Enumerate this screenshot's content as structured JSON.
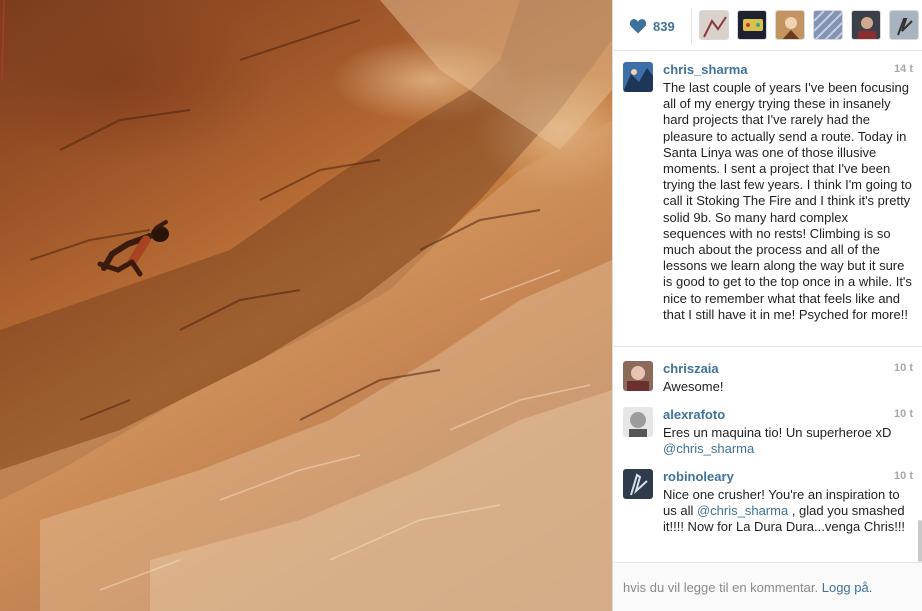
{
  "likes": {
    "count": "839",
    "icon": "heart-icon",
    "likers": [
      {
        "avatar": "liker-avatar-1",
        "color": "#c9c3bd"
      },
      {
        "avatar": "liker-avatar-2",
        "color": "#2b2b3a"
      },
      {
        "avatar": "liker-avatar-3",
        "color": "#b88a5a"
      },
      {
        "avatar": "liker-avatar-4",
        "color": "#7d8aa8"
      },
      {
        "avatar": "liker-avatar-5",
        "color": "#3a3f4a"
      },
      {
        "avatar": "liker-avatar-6",
        "color": "#9aa7b8"
      }
    ]
  },
  "caption": {
    "username": "chris_sharma",
    "time": "14 t",
    "text": "The last couple of years I've been focusing all of my energy trying these in insanely hard projects that I've rarely had the pleasure to actually send a route. Today in Santa Linya was one of those illusive moments. I sent a project that I've been trying the last few years. I think I'm going to call it Stoking The Fire and I think it's pretty solid 9b. So many hard complex sequences with no rests! Climbing is so much about the process and all of the lessons we learn along the way but it sure is good to get to the top once in a while. It's nice to remember what that feels like and that I still have it in me! Psyched for more!!"
  },
  "comments": [
    {
      "username": "chriszaia",
      "time": "10 t",
      "text": "Awesome!",
      "mention": "",
      "text_after": ""
    },
    {
      "username": "alexrafoto",
      "time": "10 t",
      "text": "Eres un maquina tio! Un superheroe xD ",
      "mention": "@chris_sharma",
      "text_after": ""
    },
    {
      "username": "robinoleary",
      "time": "10 t",
      "text": "Nice one crusher! You're an inspiration to us all ",
      "mention": "@chris_sharma",
      "text_after": " , glad you smashed it!!!! Now for La Dura Dura...venga Chris!!!"
    }
  ],
  "footer": {
    "prompt": "hvis du vil legge til en kommentar.",
    "login_label": "Logg på."
  },
  "colors": {
    "link": "#3f729b",
    "timestamp": "#a5a7aa"
  }
}
